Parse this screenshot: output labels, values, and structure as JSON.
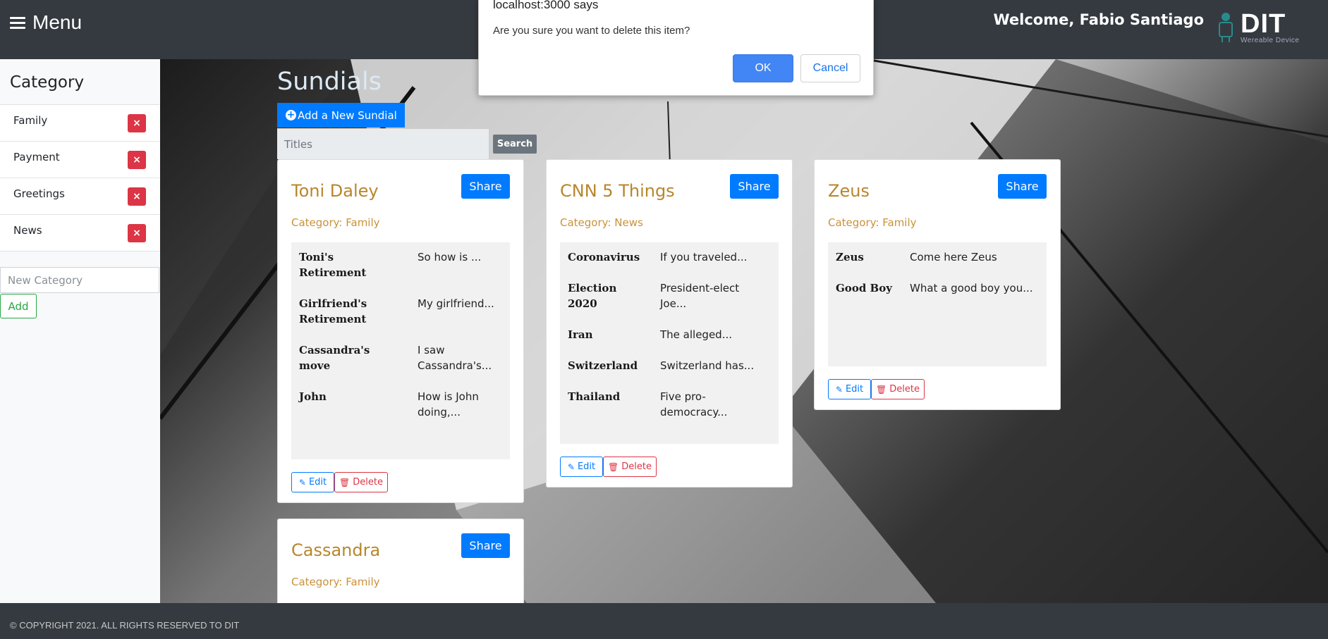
{
  "navbar": {
    "menu_label": "Menu",
    "welcome": "Welcome, Fabio Santiago",
    "logo_text": "DIT",
    "logo_subtitle": "Wereable Device"
  },
  "sidebar": {
    "title": "Category",
    "categories": [
      {
        "label": "Family",
        "delete_label": "×"
      },
      {
        "label": "Payment",
        "delete_label": "×"
      },
      {
        "label": "Greetings",
        "delete_label": "×"
      },
      {
        "label": "News",
        "delete_label": "×"
      }
    ],
    "new_category_placeholder": "New Category",
    "add_label": "Add"
  },
  "main": {
    "page_title": "Sundials",
    "add_button_label": "Add a New Sundial",
    "add_button_icon": "+",
    "search_placeholder": "Titles",
    "search_label": "Search"
  },
  "cards": [
    {
      "title": "Toni Daley",
      "share_label": "Share",
      "category": "Category: Family",
      "messages": [
        {
          "title": "Toni's Retirement",
          "body": "So how is ..."
        },
        {
          "title": "Girlfriend's Retirement",
          "body": "My girlfriend..."
        },
        {
          "title": "Cassandra's move",
          "body": "I saw Cassandra's..."
        },
        {
          "title": "John",
          "body": "How is John doing,..."
        }
      ],
      "edit_label": "Edit",
      "delete_label": "Delete"
    },
    {
      "title": "CNN 5 Things",
      "share_label": "Share",
      "category": "Category: News",
      "messages": [
        {
          "title": "Coronavirus",
          "body": "If you traveled..."
        },
        {
          "title": "Election 2020",
          "body": "President-elect Joe..."
        },
        {
          "title": "Iran",
          "body": "The alleged..."
        },
        {
          "title": "Switzerland",
          "body": "Switzerland has..."
        },
        {
          "title": "Thailand",
          "body": "Five pro-democracy..."
        }
      ],
      "edit_label": "Edit",
      "delete_label": "Delete"
    },
    {
      "title": "Zeus",
      "share_label": "Share",
      "category": "Category: Family",
      "messages": [
        {
          "title": "Zeus",
          "body": "Come here Zeus"
        },
        {
          "title": "Good Boy",
          "body": "What a good boy you..."
        }
      ],
      "edit_label": "Edit",
      "delete_label": "Delete"
    },
    {
      "title": "Cassandra",
      "share_label": "Share",
      "category": "Category: Family"
    }
  ],
  "footer": {
    "text": "© COPYRIGHT 2021. ALL RIGHTS RESERVED TO DIT"
  },
  "dialog": {
    "title": "localhost:3000 says",
    "message": "Are you sure you want to delete this item?",
    "ok_label": "OK",
    "cancel_label": "Cancel"
  },
  "colors": {
    "navbar_bg": "#343a40",
    "primary": "#007bff",
    "danger": "#dc3545",
    "success": "#28a745",
    "card_title": "#b8862b"
  }
}
